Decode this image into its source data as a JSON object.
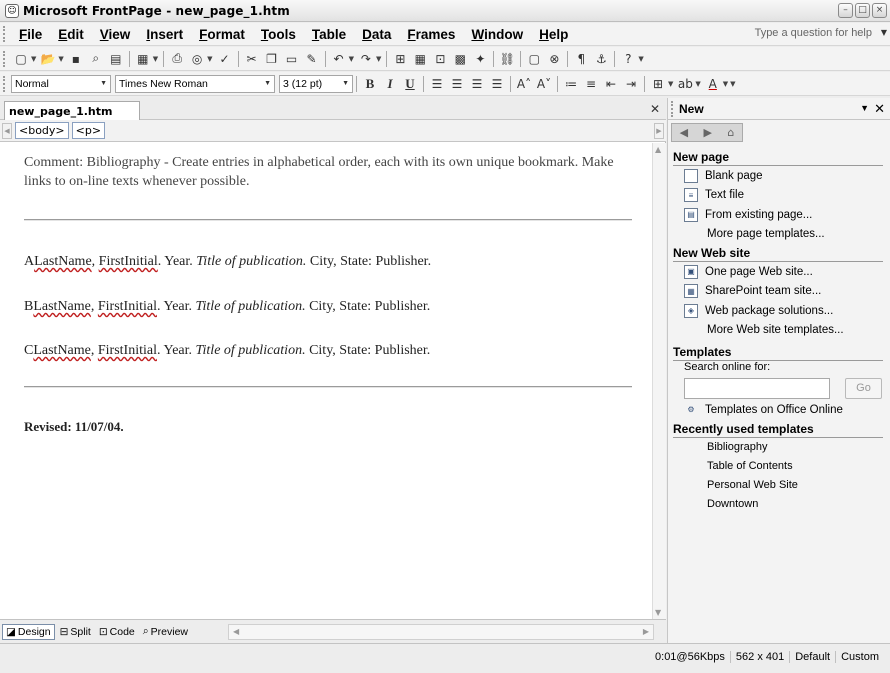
{
  "window": {
    "app_icon": "FrontPage app icon",
    "title": "Microsoft FrontPage - new_page_1.htm",
    "min": "–",
    "max": "□",
    "close": "×"
  },
  "menubar": {
    "items": [
      "File",
      "Edit",
      "View",
      "Insert",
      "Format",
      "Tools",
      "Table",
      "Data",
      "Frames",
      "Window",
      "Help"
    ],
    "question_placeholder": "Type a question for help"
  },
  "formatting": {
    "style": "Normal",
    "font": "Times New Roman",
    "size": "3 (12 pt)"
  },
  "editor": {
    "tab": "new_page_1.htm",
    "quick_tags": [
      "<body>",
      "<p>"
    ],
    "comment": "Comment: Bibliography - Create entries in alphabetical order, each with its own unique bookmark. Make links to on-line texts whenever possible.",
    "entries": [
      {
        "prefix": "A",
        "last": "LastName",
        "first": "FirstInitial",
        "rest": ". Year. ",
        "title": "Title of publication.",
        "tail": " City, State: Publisher."
      },
      {
        "prefix": "B",
        "last": "LastName",
        "first": "FirstInitial",
        "rest": ". Year. ",
        "title": "Title of publication.",
        "tail": " City, State: Publisher."
      },
      {
        "prefix": "C",
        "last": "LastName",
        "first": "FirstInitial",
        "rest": ". Year. ",
        "title": "Title of publication.",
        "tail": " City, State: Publisher."
      }
    ],
    "revised": "Revised: 11/07/04.",
    "views": [
      "Design",
      "Split",
      "Code",
      "Preview"
    ]
  },
  "task_pane": {
    "title": "New",
    "sections": {
      "new_page": "New page",
      "new_web_site": "New Web site",
      "templates": "Templates",
      "recent": "Recently used templates"
    },
    "new_page_items": [
      "Blank page",
      "Text file",
      "From existing page...",
      "More page templates..."
    ],
    "web_site_items": [
      "One page Web site...",
      "SharePoint team site...",
      "Web package solutions...",
      "More Web site templates..."
    ],
    "search_label": "Search online for:",
    "go": "Go",
    "office_online": "Templates on Office Online",
    "recent_items": [
      "Bibliography",
      "Table of Contents",
      "Personal Web Site",
      "Downtown"
    ]
  },
  "status": {
    "speed": "0:01@56Kbps",
    "size": "562 x 401",
    "default": "Default",
    "custom": "Custom"
  }
}
